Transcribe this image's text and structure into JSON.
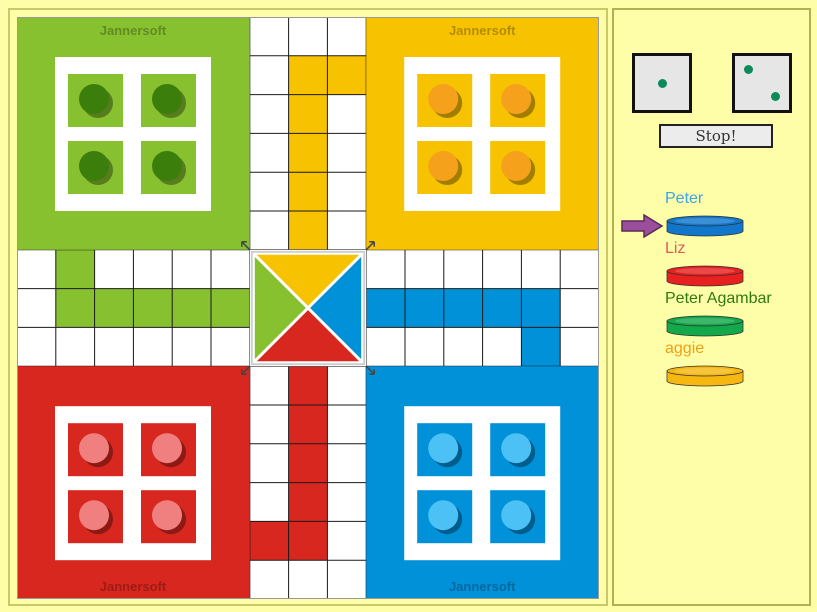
{
  "board": {
    "watermark": "Jannersoft",
    "colors": {
      "green": "#87c130",
      "yellow": "#f7c200",
      "red": "#d8271e",
      "blue": "#0091d9"
    },
    "token_colors": {
      "green": "#3c7e0c",
      "yellow": "#f6a11b",
      "red": "#f08080",
      "blue": "#4cc1f5"
    }
  },
  "dice": {
    "die1": 1,
    "die2": 2,
    "pip_color": "#0d8a5a",
    "stop_label": "Stop!"
  },
  "players": [
    {
      "name": "Peter",
      "name_color": "#3aa3f0",
      "disc_color": "#1177cc",
      "current": true
    },
    {
      "name": "Liz",
      "name_color": "#e05a5a",
      "disc_color": "#e82020",
      "current": false
    },
    {
      "name": "Peter Agambar",
      "name_color": "#2e7a10",
      "disc_color": "#13a84a",
      "current": false
    },
    {
      "name": "aggie",
      "name_color": "#f0a018",
      "disc_color": "#f6b810",
      "current": false
    }
  ]
}
